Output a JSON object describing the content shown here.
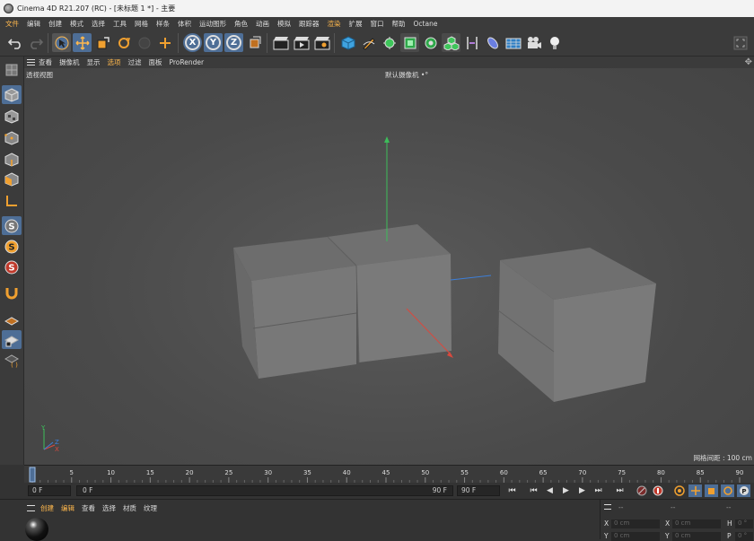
{
  "window": {
    "title": "Cinema 4D R21.207 (RC) - [未标题 1 *] - 主要"
  },
  "menu": {
    "items": [
      "文件",
      "编辑",
      "创建",
      "模式",
      "选择",
      "工具",
      "网格",
      "样条",
      "体积",
      "运动图形",
      "角色",
      "动画",
      "模拟",
      "跟踪器",
      "渲染",
      "扩展",
      "窗口",
      "帮助",
      "Octane"
    ]
  },
  "toolbar": {
    "axis_x": "X",
    "axis_y": "Y",
    "axis_z": "Z"
  },
  "viewport_menu": {
    "items": [
      "查看",
      "摄像机",
      "显示",
      "选项",
      "过滤",
      "面板",
      "ProRender"
    ],
    "active_index": 3
  },
  "viewport": {
    "view_name": "透视视图",
    "camera_label": "默认摄像机",
    "grid_label": "网格间距 : 100 cm",
    "axis_labels": {
      "x": "X",
      "y": "Y",
      "z": "Z"
    }
  },
  "timeline": {
    "ticks": [
      "0",
      "5",
      "10",
      "15",
      "20",
      "25",
      "30",
      "35",
      "40",
      "45",
      "50",
      "55",
      "60",
      "65",
      "70",
      "75",
      "80",
      "85",
      "90"
    ],
    "current_frame": "0 F"
  },
  "playback": {
    "start_field": "0 F",
    "range_start": "0 F",
    "range_end": "90 F",
    "end_field": "90 F"
  },
  "material_menu": {
    "items": [
      "创建",
      "编辑",
      "查看",
      "选择",
      "材质",
      "纹理"
    ]
  },
  "attributes": {
    "rows": [
      {
        "label1": "X",
        "value1": "0 cm",
        "label2": "X",
        "value2": "0 cm",
        "label3": "H",
        "value3": "0 °"
      },
      {
        "label1": "Y",
        "value1": "0 cm",
        "label2": "Y",
        "value2": "0 cm",
        "label3": "P",
        "value3": "0 °"
      }
    ],
    "header": "--"
  },
  "colors": {
    "accent": "#ffb84d",
    "selected_button": "#4e6e96",
    "axis_x": "#d9493e",
    "axis_y": "#3dbd5a",
    "axis_z": "#3d7fd9"
  }
}
